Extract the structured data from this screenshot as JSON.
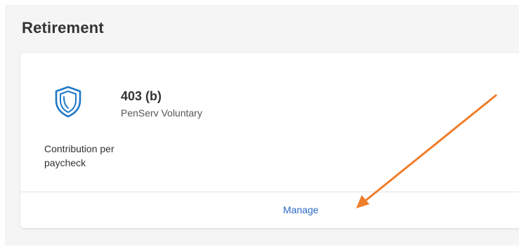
{
  "section": {
    "title": "Retirement"
  },
  "plan": {
    "icon": "shield-icon",
    "name": "403 (b)",
    "provider": "PenServ Voluntary",
    "contribution_label": "Contribution per paycheck",
    "manage_label": "Manage"
  },
  "colors": {
    "accent": "#1f78c8",
    "link": "#2a6ac4",
    "annotation": "#ef7d2a"
  }
}
